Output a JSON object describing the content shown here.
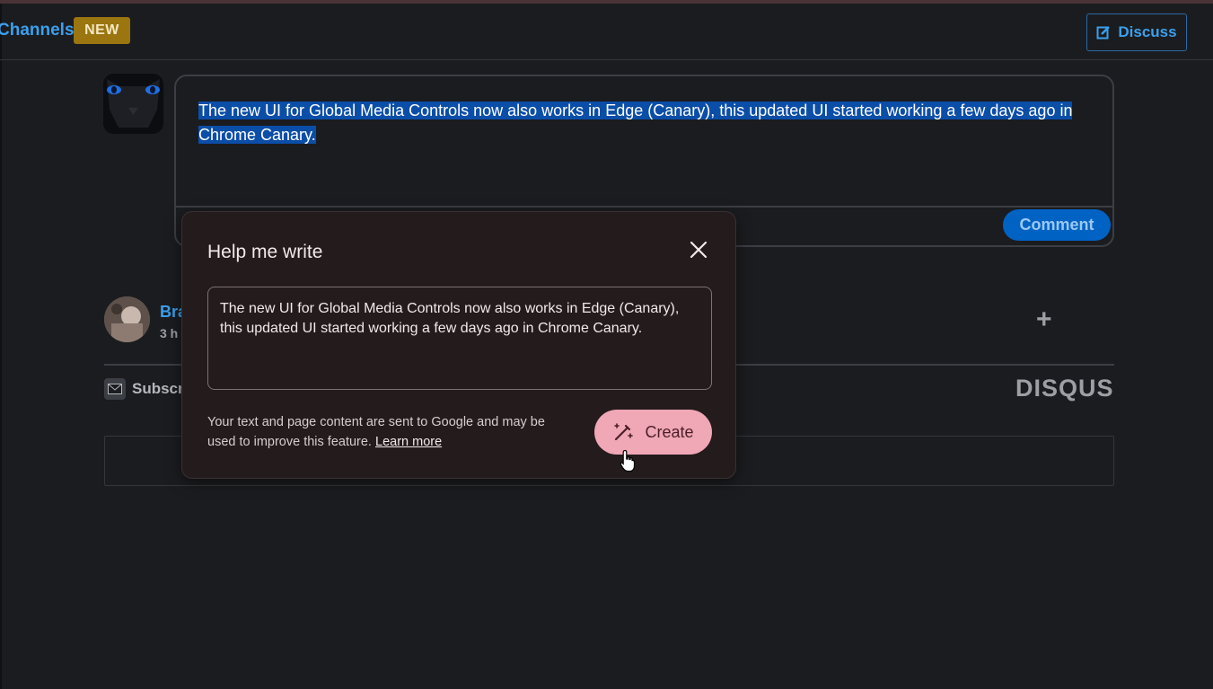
{
  "nav": {
    "channels_label": "Channels",
    "new_badge": "NEW",
    "discuss_label": "Discuss"
  },
  "composer": {
    "text": "The new UI for Global Media Controls now also works in Edge (Canary), this updated UI started working a few days ago in Chrome Canary.",
    "comment_label": "Comment"
  },
  "comment": {
    "author": "Bra",
    "time": "3 h",
    "add_label": "+"
  },
  "footer": {
    "subscribe_label": "Subscr",
    "brand": "DISQUS"
  },
  "help_me_write": {
    "title": "Help me write",
    "input_text": "The new UI for Global Media Controls now also works in Edge (Canary), this updated UI started working a few days ago in Chrome Canary.",
    "note": "Your text and page content are sent to Google and may be used to improve this feature.",
    "learn_more": "Learn more",
    "create_label": "Create"
  },
  "colors": {
    "background": "#1b1c1f",
    "link_blue": "#3aa0ee",
    "selection": "#0b4ea8",
    "dialog_bg": "#241b1c",
    "create_pink": "#f0a7b6",
    "new_badge": "#9a7510"
  },
  "icons": {
    "discuss": "edit-icon",
    "close": "close-icon",
    "create": "magic-pen-icon",
    "subscribe": "envelope-icon",
    "cursor": "hand-pointer-icon"
  }
}
